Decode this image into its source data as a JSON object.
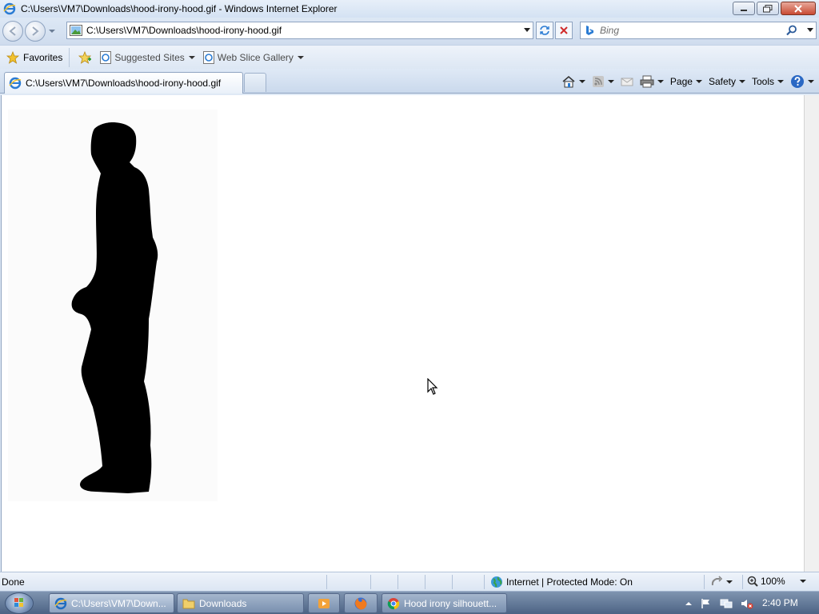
{
  "window": {
    "title": "C:\\Users\\VM7\\Downloads\\hood-irony-hood.gif - Windows Internet Explorer"
  },
  "address_bar": {
    "url": "C:\\Users\\VM7\\Downloads\\hood-irony-hood.gif"
  },
  "search": {
    "placeholder": "Bing"
  },
  "favorites_bar": {
    "favorites_label": "Favorites",
    "items": [
      "Suggested Sites",
      "Web Slice Gallery"
    ]
  },
  "tabs": [
    {
      "label": "C:\\Users\\VM7\\Downloads\\hood-irony-hood.gif"
    }
  ],
  "command_bar": {
    "page_label": "Page",
    "safety_label": "Safety",
    "tools_label": "Tools"
  },
  "status_bar": {
    "status": "Done",
    "zone": "Internet | Protected Mode: On",
    "zoom": "100%"
  },
  "taskbar": {
    "tasks": [
      {
        "label": "C:\\Users\\VM7\\Down..."
      },
      {
        "label": "Downloads"
      },
      {
        "label": "Hood irony silhouett..."
      }
    ],
    "clock": "2:40 PM"
  },
  "colors": {
    "chrome_bg": "#dfe9f5",
    "close_button": "#c84b33",
    "taskbar": "#4c6384"
  }
}
